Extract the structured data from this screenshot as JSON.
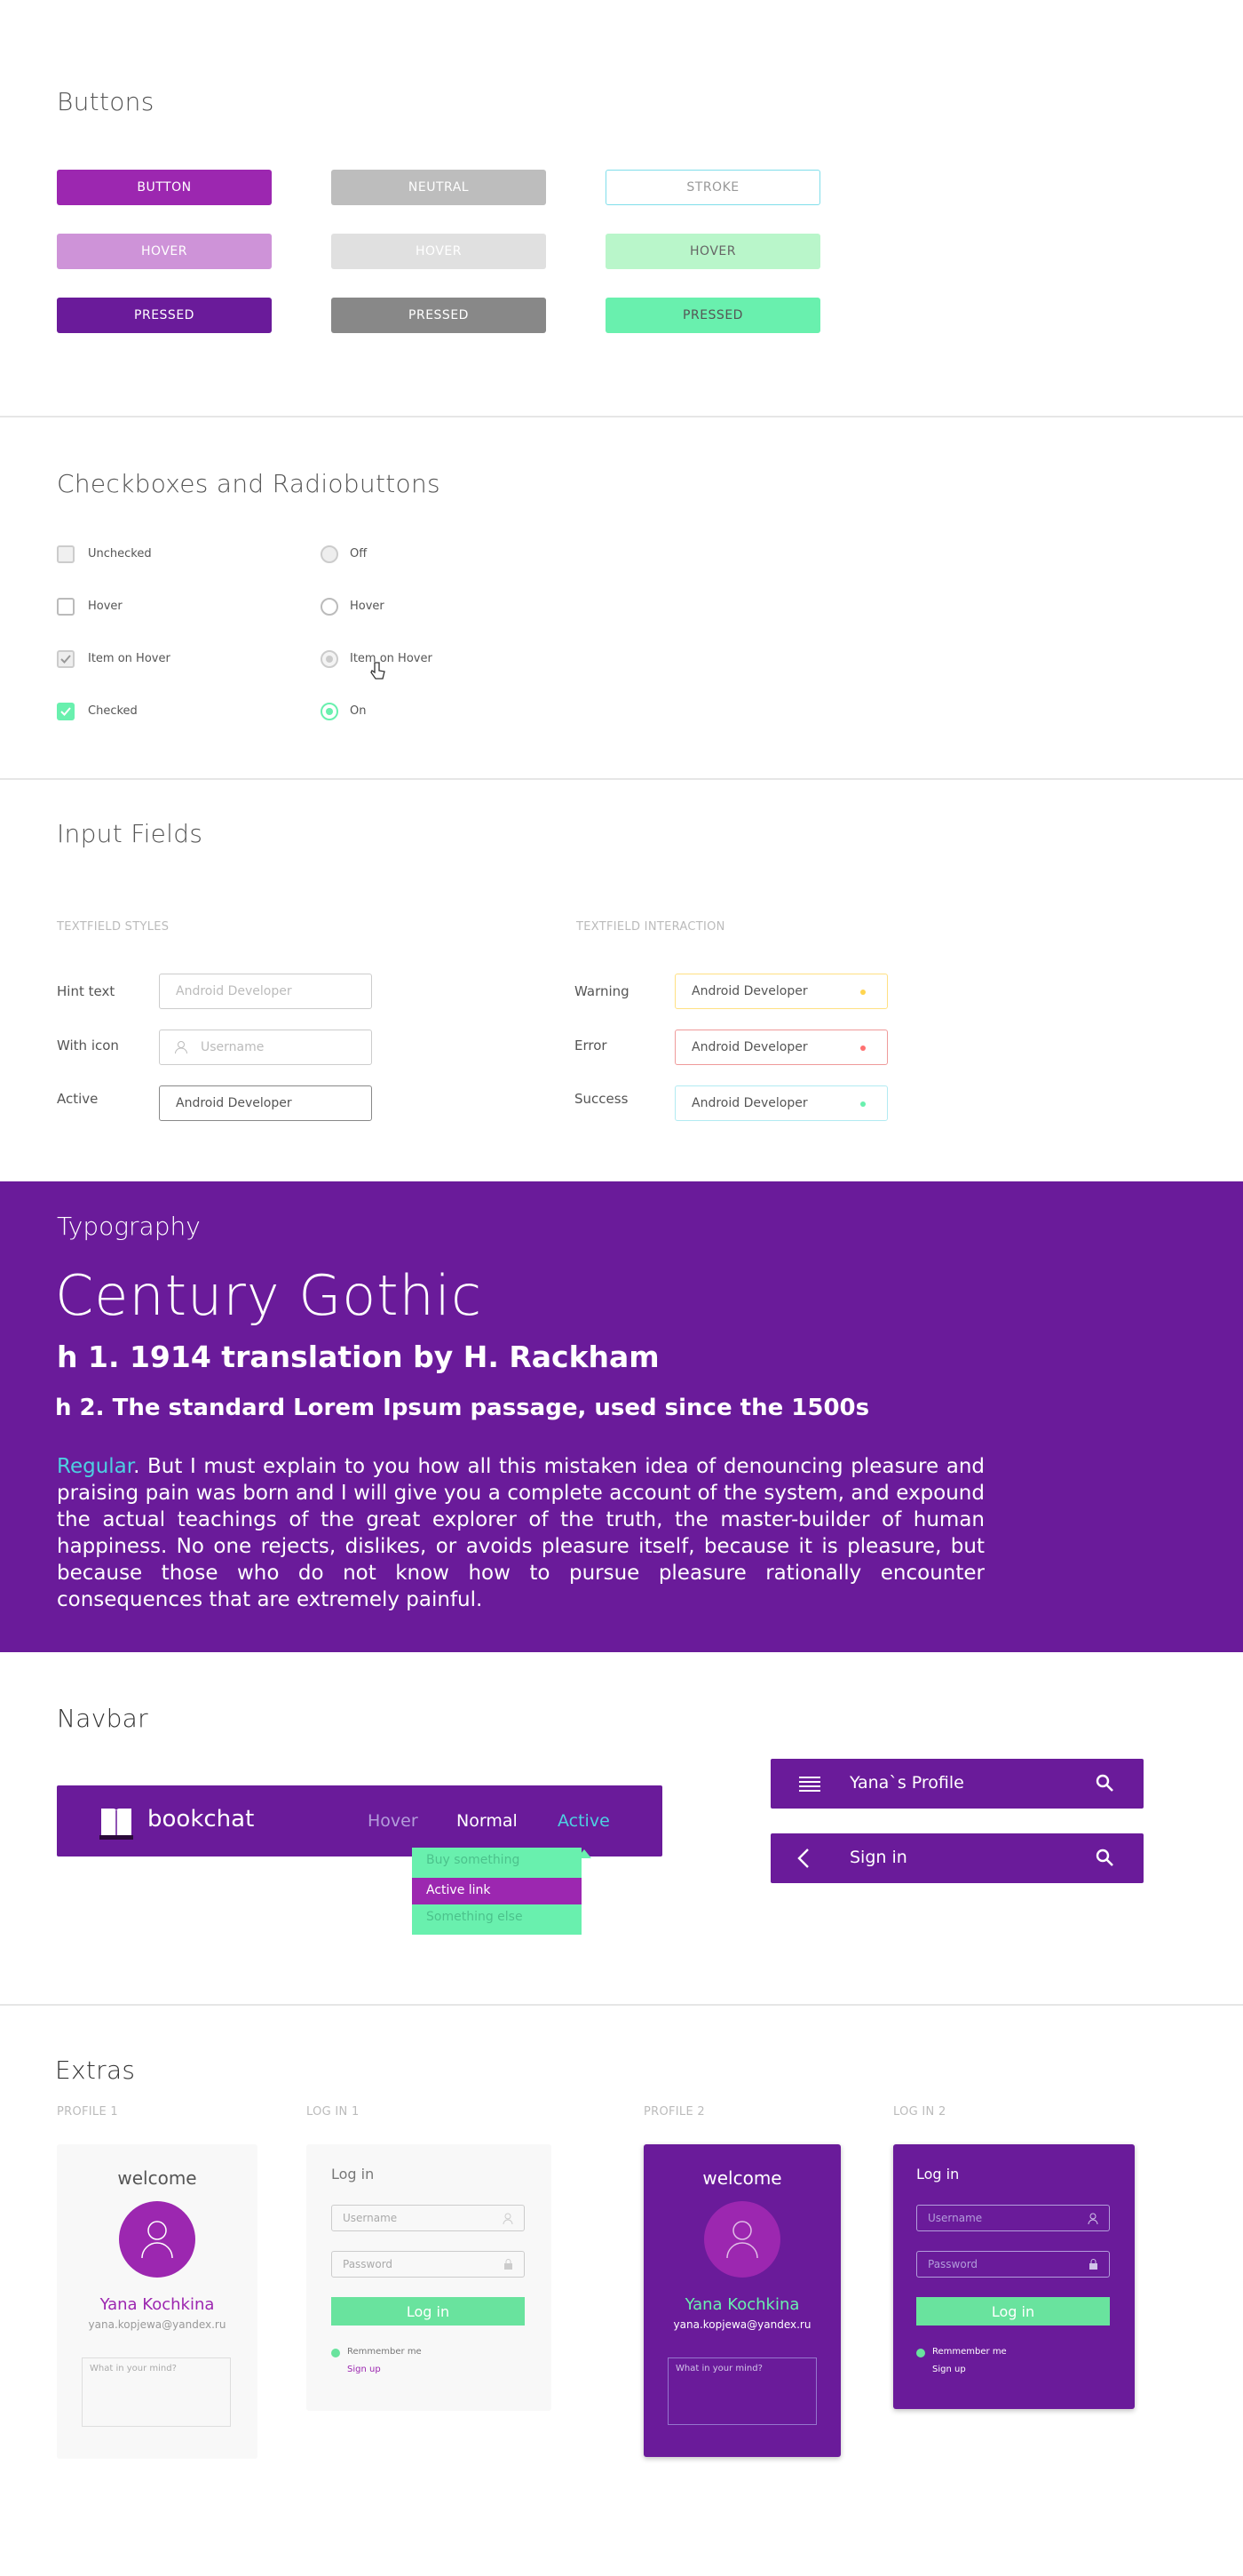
{
  "colors": {
    "accent": "#9c27b0",
    "accent_dark": "#6a1b9a",
    "mint": "#69f0ae",
    "purple_bg": "#6a1b9a",
    "teal_text": "#4dd0e1"
  },
  "buttons": {
    "title": "Buttons",
    "b1": "BUTTON",
    "b2": "NEUTRAL",
    "b3": "STROKE",
    "h1": "HOVER",
    "h2": "HOVER",
    "h3": "HOVER",
    "p1": "PRESSED",
    "p2": "PRESSED",
    "p3": "PRESSED"
  },
  "checks": {
    "title": "Checkboxes and Radiobuttons",
    "c1": "Unchecked",
    "c2": "Hover",
    "c3": "Item on Hover",
    "c4": "Checked",
    "r1": "Off",
    "r2": "Hover",
    "r3": "Item on Hover",
    "r4": "On"
  },
  "inputs": {
    "title": "Input Fields",
    "cap_left": "TEXTFIELD STYLES",
    "cap_right": "TEXTFIELD INTERACTION",
    "l1": "Hint text",
    "l2": "With icon",
    "l3": "Active",
    "v1": "Android Developer",
    "v2": "Username",
    "v3": "Android Developer",
    "r1": "Warning",
    "r2": "Error",
    "r3": "Success",
    "rv1": "Android Developer",
    "rv2": "Android Developer",
    "rv3": "Android Developer"
  },
  "typography": {
    "title": "Typography",
    "font": "Century Gothic",
    "h1": "h 1. 1914 translation by H. Rackham",
    "h2": "h 2. The standard Lorem Ipsum passage, used since the 1500s",
    "regular": "Regular",
    "body": ". But I must explain to you how all this mistaken idea of denouncing pleasure and praising pain was born and I will give you a complete account of the system, and expound the actual teachings of the great explorer of the truth, the master-builder of human happiness. No one rejects, dislikes, or avoids pleasure itself, because it is pleasure, but because those who do not know how to pursue pleasure rationally encounter consequences that are extremely painful."
  },
  "navbar": {
    "title": "Navbar",
    "brand": "bookchat",
    "hover": "Hover",
    "normal": "Normal",
    "active": "Active",
    "dd1": "Buy something",
    "dd2": "Active link",
    "dd3": "Something else",
    "bar1": "Yana`s Profile",
    "bar2": "Sign in"
  },
  "extras": {
    "title": "Extras",
    "cap1": "PROFILE 1",
    "cap2": "LOG IN 1",
    "cap3": "PROFILE 2",
    "cap4": "LOG IN 2",
    "welcome": "welcome",
    "name": "Yana Kochkina",
    "email": "yana.kopjewa@yandex.ru",
    "mind": "What in your mind?",
    "login": "Log in",
    "username": "Username",
    "password": "Password",
    "login_btn": "Log in",
    "remember": "Remmember me",
    "signup": "Sign up"
  }
}
